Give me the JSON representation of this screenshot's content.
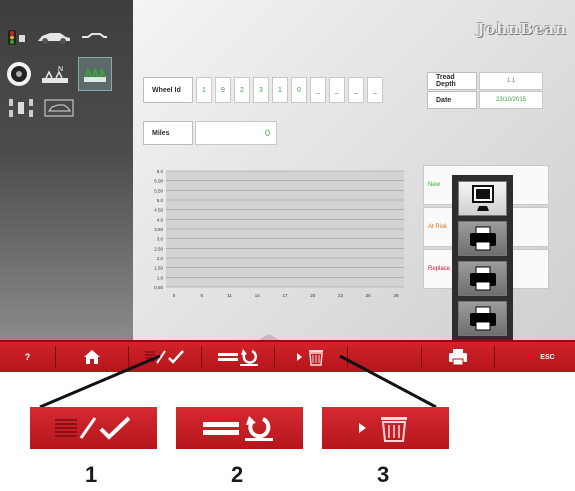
{
  "brand": "JohnBean",
  "wheel": {
    "label": "Wheel Id",
    "digits": [
      "1",
      "9",
      "2",
      "3",
      "1",
      "0",
      "_",
      "_",
      "_",
      "_"
    ]
  },
  "tread": {
    "depth_label": "Tread Depth",
    "depth_value": "1.1",
    "date_label": "Date",
    "date_value": "23/10/2015"
  },
  "miles": {
    "label": "Miles",
    "value": "0"
  },
  "chart_data": {
    "type": "area",
    "y_ticks": [
      "8.0",
      "5.00",
      "5.50",
      "5.0",
      "4.50",
      "4.0",
      "3.50",
      "3.0",
      "2.50",
      "2.0",
      "1.50",
      "1.0",
      "0.50"
    ],
    "x_ticks": [
      "5",
      "8",
      "11",
      "14",
      "17",
      "20",
      "23",
      "26",
      "29"
    ],
    "grid": true,
    "title": "",
    "xlabel": "",
    "ylabel": ""
  },
  "legend": [
    {
      "label": "New",
      "color": "#3aa63a"
    },
    {
      "label": "At Risk",
      "color": "#e0701a"
    },
    {
      "label": "Replace",
      "color": "#c21a2a"
    }
  ],
  "bottom_bar": {
    "help_label": "?",
    "esc_label": "ESC"
  },
  "callouts": [
    "1",
    "2",
    "3"
  ],
  "colors": {
    "bar_red": "#c41a21",
    "accent_green": "#3aa63a",
    "sidebar_dark": "#3e3e3e"
  }
}
